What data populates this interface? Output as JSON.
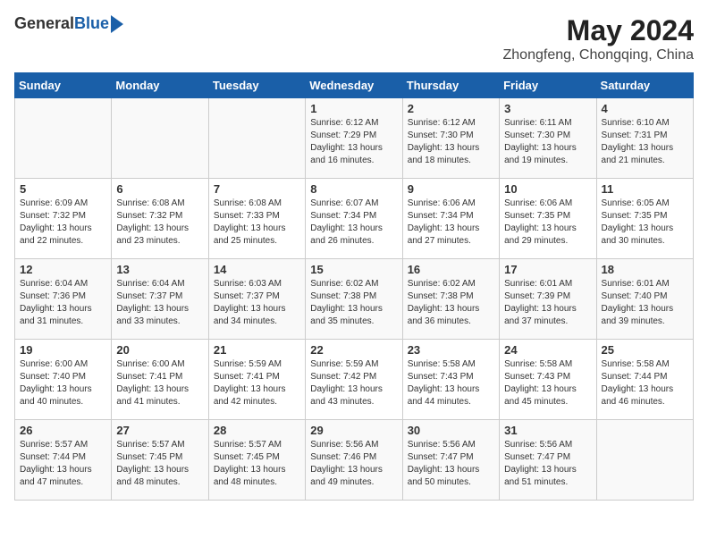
{
  "header": {
    "logo_general": "General",
    "logo_blue": "Blue",
    "month_title": "May 2024",
    "location": "Zhongfeng, Chongqing, China"
  },
  "days_of_week": [
    "Sunday",
    "Monday",
    "Tuesday",
    "Wednesday",
    "Thursday",
    "Friday",
    "Saturday"
  ],
  "weeks": [
    [
      {
        "num": "",
        "sunrise": "",
        "sunset": "",
        "daylight": ""
      },
      {
        "num": "",
        "sunrise": "",
        "sunset": "",
        "daylight": ""
      },
      {
        "num": "",
        "sunrise": "",
        "sunset": "",
        "daylight": ""
      },
      {
        "num": "1",
        "sunrise": "Sunrise: 6:12 AM",
        "sunset": "Sunset: 7:29 PM",
        "daylight": "Daylight: 13 hours and 16 minutes."
      },
      {
        "num": "2",
        "sunrise": "Sunrise: 6:12 AM",
        "sunset": "Sunset: 7:30 PM",
        "daylight": "Daylight: 13 hours and 18 minutes."
      },
      {
        "num": "3",
        "sunrise": "Sunrise: 6:11 AM",
        "sunset": "Sunset: 7:30 PM",
        "daylight": "Daylight: 13 hours and 19 minutes."
      },
      {
        "num": "4",
        "sunrise": "Sunrise: 6:10 AM",
        "sunset": "Sunset: 7:31 PM",
        "daylight": "Daylight: 13 hours and 21 minutes."
      }
    ],
    [
      {
        "num": "5",
        "sunrise": "Sunrise: 6:09 AM",
        "sunset": "Sunset: 7:32 PM",
        "daylight": "Daylight: 13 hours and 22 minutes."
      },
      {
        "num": "6",
        "sunrise": "Sunrise: 6:08 AM",
        "sunset": "Sunset: 7:32 PM",
        "daylight": "Daylight: 13 hours and 23 minutes."
      },
      {
        "num": "7",
        "sunrise": "Sunrise: 6:08 AM",
        "sunset": "Sunset: 7:33 PM",
        "daylight": "Daylight: 13 hours and 25 minutes."
      },
      {
        "num": "8",
        "sunrise": "Sunrise: 6:07 AM",
        "sunset": "Sunset: 7:34 PM",
        "daylight": "Daylight: 13 hours and 26 minutes."
      },
      {
        "num": "9",
        "sunrise": "Sunrise: 6:06 AM",
        "sunset": "Sunset: 7:34 PM",
        "daylight": "Daylight: 13 hours and 27 minutes."
      },
      {
        "num": "10",
        "sunrise": "Sunrise: 6:06 AM",
        "sunset": "Sunset: 7:35 PM",
        "daylight": "Daylight: 13 hours and 29 minutes."
      },
      {
        "num": "11",
        "sunrise": "Sunrise: 6:05 AM",
        "sunset": "Sunset: 7:35 PM",
        "daylight": "Daylight: 13 hours and 30 minutes."
      }
    ],
    [
      {
        "num": "12",
        "sunrise": "Sunrise: 6:04 AM",
        "sunset": "Sunset: 7:36 PM",
        "daylight": "Daylight: 13 hours and 31 minutes."
      },
      {
        "num": "13",
        "sunrise": "Sunrise: 6:04 AM",
        "sunset": "Sunset: 7:37 PM",
        "daylight": "Daylight: 13 hours and 33 minutes."
      },
      {
        "num": "14",
        "sunrise": "Sunrise: 6:03 AM",
        "sunset": "Sunset: 7:37 PM",
        "daylight": "Daylight: 13 hours and 34 minutes."
      },
      {
        "num": "15",
        "sunrise": "Sunrise: 6:02 AM",
        "sunset": "Sunset: 7:38 PM",
        "daylight": "Daylight: 13 hours and 35 minutes."
      },
      {
        "num": "16",
        "sunrise": "Sunrise: 6:02 AM",
        "sunset": "Sunset: 7:38 PM",
        "daylight": "Daylight: 13 hours and 36 minutes."
      },
      {
        "num": "17",
        "sunrise": "Sunrise: 6:01 AM",
        "sunset": "Sunset: 7:39 PM",
        "daylight": "Daylight: 13 hours and 37 minutes."
      },
      {
        "num": "18",
        "sunrise": "Sunrise: 6:01 AM",
        "sunset": "Sunset: 7:40 PM",
        "daylight": "Daylight: 13 hours and 39 minutes."
      }
    ],
    [
      {
        "num": "19",
        "sunrise": "Sunrise: 6:00 AM",
        "sunset": "Sunset: 7:40 PM",
        "daylight": "Daylight: 13 hours and 40 minutes."
      },
      {
        "num": "20",
        "sunrise": "Sunrise: 6:00 AM",
        "sunset": "Sunset: 7:41 PM",
        "daylight": "Daylight: 13 hours and 41 minutes."
      },
      {
        "num": "21",
        "sunrise": "Sunrise: 5:59 AM",
        "sunset": "Sunset: 7:41 PM",
        "daylight": "Daylight: 13 hours and 42 minutes."
      },
      {
        "num": "22",
        "sunrise": "Sunrise: 5:59 AM",
        "sunset": "Sunset: 7:42 PM",
        "daylight": "Daylight: 13 hours and 43 minutes."
      },
      {
        "num": "23",
        "sunrise": "Sunrise: 5:58 AM",
        "sunset": "Sunset: 7:43 PM",
        "daylight": "Daylight: 13 hours and 44 minutes."
      },
      {
        "num": "24",
        "sunrise": "Sunrise: 5:58 AM",
        "sunset": "Sunset: 7:43 PM",
        "daylight": "Daylight: 13 hours and 45 minutes."
      },
      {
        "num": "25",
        "sunrise": "Sunrise: 5:58 AM",
        "sunset": "Sunset: 7:44 PM",
        "daylight": "Daylight: 13 hours and 46 minutes."
      }
    ],
    [
      {
        "num": "26",
        "sunrise": "Sunrise: 5:57 AM",
        "sunset": "Sunset: 7:44 PM",
        "daylight": "Daylight: 13 hours and 47 minutes."
      },
      {
        "num": "27",
        "sunrise": "Sunrise: 5:57 AM",
        "sunset": "Sunset: 7:45 PM",
        "daylight": "Daylight: 13 hours and 48 minutes."
      },
      {
        "num": "28",
        "sunrise": "Sunrise: 5:57 AM",
        "sunset": "Sunset: 7:45 PM",
        "daylight": "Daylight: 13 hours and 48 minutes."
      },
      {
        "num": "29",
        "sunrise": "Sunrise: 5:56 AM",
        "sunset": "Sunset: 7:46 PM",
        "daylight": "Daylight: 13 hours and 49 minutes."
      },
      {
        "num": "30",
        "sunrise": "Sunrise: 5:56 AM",
        "sunset": "Sunset: 7:47 PM",
        "daylight": "Daylight: 13 hours and 50 minutes."
      },
      {
        "num": "31",
        "sunrise": "Sunrise: 5:56 AM",
        "sunset": "Sunset: 7:47 PM",
        "daylight": "Daylight: 13 hours and 51 minutes."
      },
      {
        "num": "",
        "sunrise": "",
        "sunset": "",
        "daylight": ""
      }
    ]
  ]
}
